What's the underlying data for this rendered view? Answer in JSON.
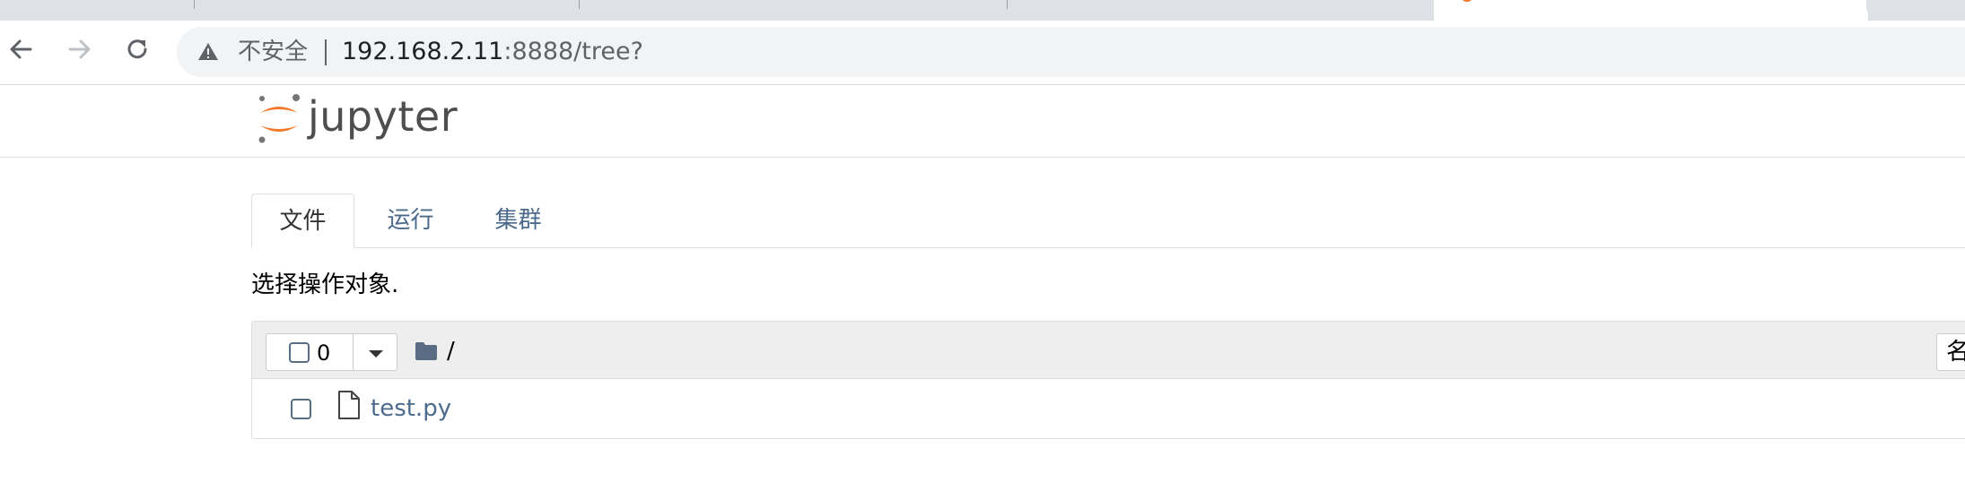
{
  "browser": {
    "address_warning": "不安全",
    "url_host": "192.168.2.11",
    "url_rest": ":8888/tree?"
  },
  "app": {
    "logo_text": "jupyter"
  },
  "tabs": [
    {
      "label": "文件",
      "active": true
    },
    {
      "label": "运行",
      "active": false
    },
    {
      "label": "集群",
      "active": false
    }
  ],
  "file_browser": {
    "prompt": "选择操作对象.",
    "selected_count": "0",
    "path": "/",
    "sort_label": "名",
    "rows": [
      {
        "name": "test.py",
        "icon": "file-icon"
      }
    ]
  },
  "colors": {
    "accent_orange": "#f37726",
    "link_blue": "#4c6a8c"
  }
}
